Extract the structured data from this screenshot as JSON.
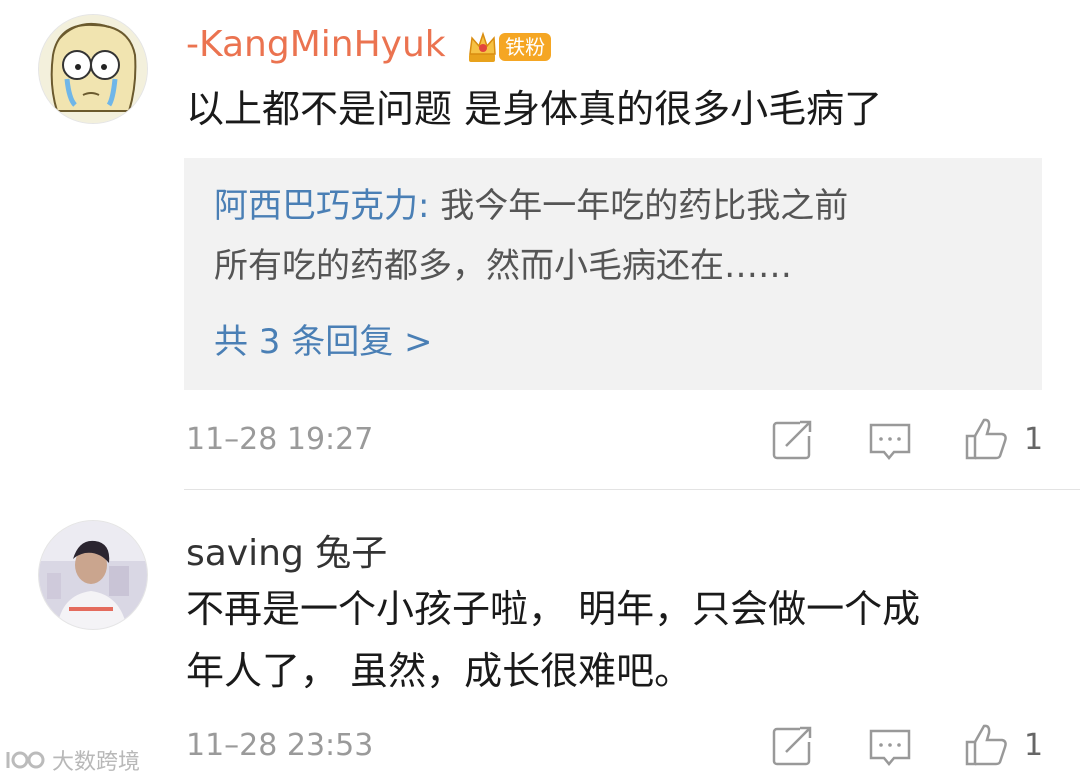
{
  "comments": [
    {
      "username": "-KangMinHyuk",
      "badge": "铁粉",
      "username_color": "#eb7350",
      "text_lines": [
        "以上都不是问题 是身体真的很多小毛病了"
      ],
      "reply": {
        "name": "阿西巴巧克力",
        "sep": ":",
        "text_line1": " 我今年一年吃的药比我之前",
        "text_line2": "所有吃的药都多，然而小毛病还在……",
        "count_label": "共 3 条回复 >"
      },
      "time": "11–28 19:27",
      "likes": "1"
    },
    {
      "username": "saving 兔子",
      "username_color": "#333333",
      "text_lines": [
        "不再是一个小孩子啦， 明年，只会做一个成",
        "年人了， 虽然，成长很难吧。"
      ],
      "time": "11–28 23:53",
      "likes": "1"
    }
  ],
  "watermark": "大数跨境",
  "icons": [
    "share-icon",
    "comment-icon",
    "like-icon"
  ]
}
